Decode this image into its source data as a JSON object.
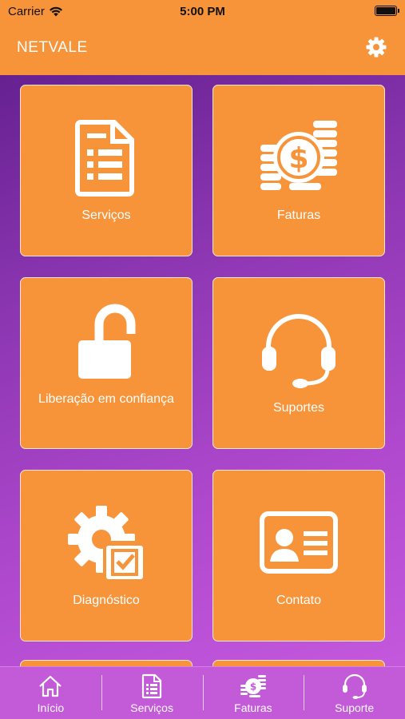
{
  "status_bar": {
    "carrier": "Carrier",
    "time": "5:00 PM"
  },
  "header": {
    "title": "NETVALE",
    "settings_icon": "gear-icon"
  },
  "tiles": [
    {
      "label": "Serviços",
      "icon": "document-list-icon"
    },
    {
      "label": "Faturas",
      "icon": "dollar-coins-icon"
    },
    {
      "label": "Liberação em confiança",
      "icon": "unlocked-padlock-icon"
    },
    {
      "label": "Suportes",
      "icon": "headset-icon"
    },
    {
      "label": "Diagnóstico",
      "icon": "gear-checkbox-icon"
    },
    {
      "label": "Contato",
      "icon": "contact-card-icon"
    }
  ],
  "tab_bar": [
    {
      "label": "Início",
      "icon": "home-icon"
    },
    {
      "label": "Serviços",
      "icon": "document-list-icon"
    },
    {
      "label": "Faturas",
      "icon": "dollar-coins-icon"
    },
    {
      "label": "Suporte",
      "icon": "headset-icon"
    }
  ],
  "colors": {
    "accent": "#f7943a",
    "tile_border": "#fde7d1",
    "background_start": "#5a1a86",
    "background_end": "#c85ce0",
    "tab_bar": "#c35ad8"
  }
}
